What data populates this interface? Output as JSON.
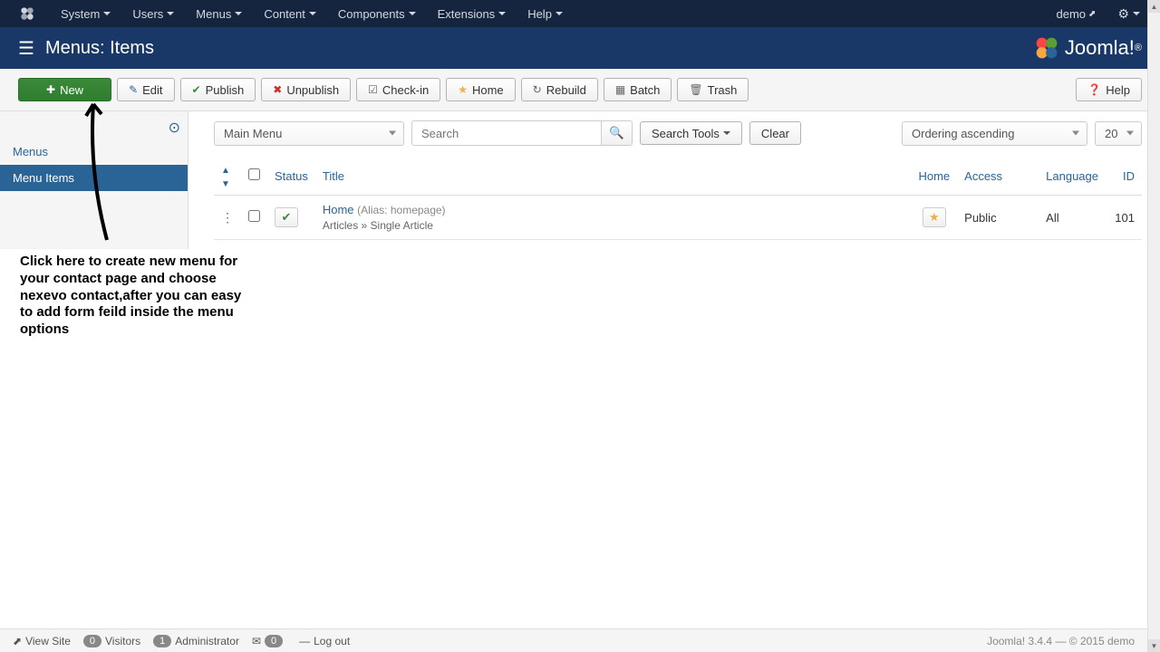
{
  "nav": {
    "items": [
      "System",
      "Users",
      "Menus",
      "Content",
      "Components",
      "Extensions",
      "Help"
    ],
    "user": "demo"
  },
  "header": {
    "title": "Menus: Items",
    "brand": "Joomla!"
  },
  "toolbar": {
    "new": "New",
    "edit": "Edit",
    "publish": "Publish",
    "unpublish": "Unpublish",
    "checkin": "Check-in",
    "home": "Home",
    "rebuild": "Rebuild",
    "batch": "Batch",
    "trash": "Trash",
    "help": "Help"
  },
  "sidebar": {
    "items": [
      {
        "label": "Menus",
        "active": false
      },
      {
        "label": "Menu Items",
        "active": true
      }
    ]
  },
  "filters": {
    "menu_select": "Main Menu",
    "search_placeholder": "Search",
    "search_tools": "Search Tools",
    "clear": "Clear",
    "ordering": "Ordering ascending",
    "limit": "20"
  },
  "table": {
    "headers": {
      "status": "Status",
      "title": "Title",
      "home": "Home",
      "access": "Access",
      "language": "Language",
      "id": "ID"
    },
    "rows": [
      {
        "title": "Home",
        "alias": "(Alias: homepage)",
        "meta": "Articles » Single Article",
        "access": "Public",
        "language": "All",
        "id": "101"
      }
    ]
  },
  "annotation": {
    "text": "Click here to create new menu for your contact page and choose nexevo contact,after you can easy to add form feild inside the menu options"
  },
  "statusbar": {
    "view_site": "View Site",
    "visitors_count": "0",
    "visitors": "Visitors",
    "admin_count": "1",
    "admin": "Administrator",
    "msg_count": "0",
    "logout": "Log out",
    "version": "Joomla! 3.4.4 — © 2015 demo"
  }
}
